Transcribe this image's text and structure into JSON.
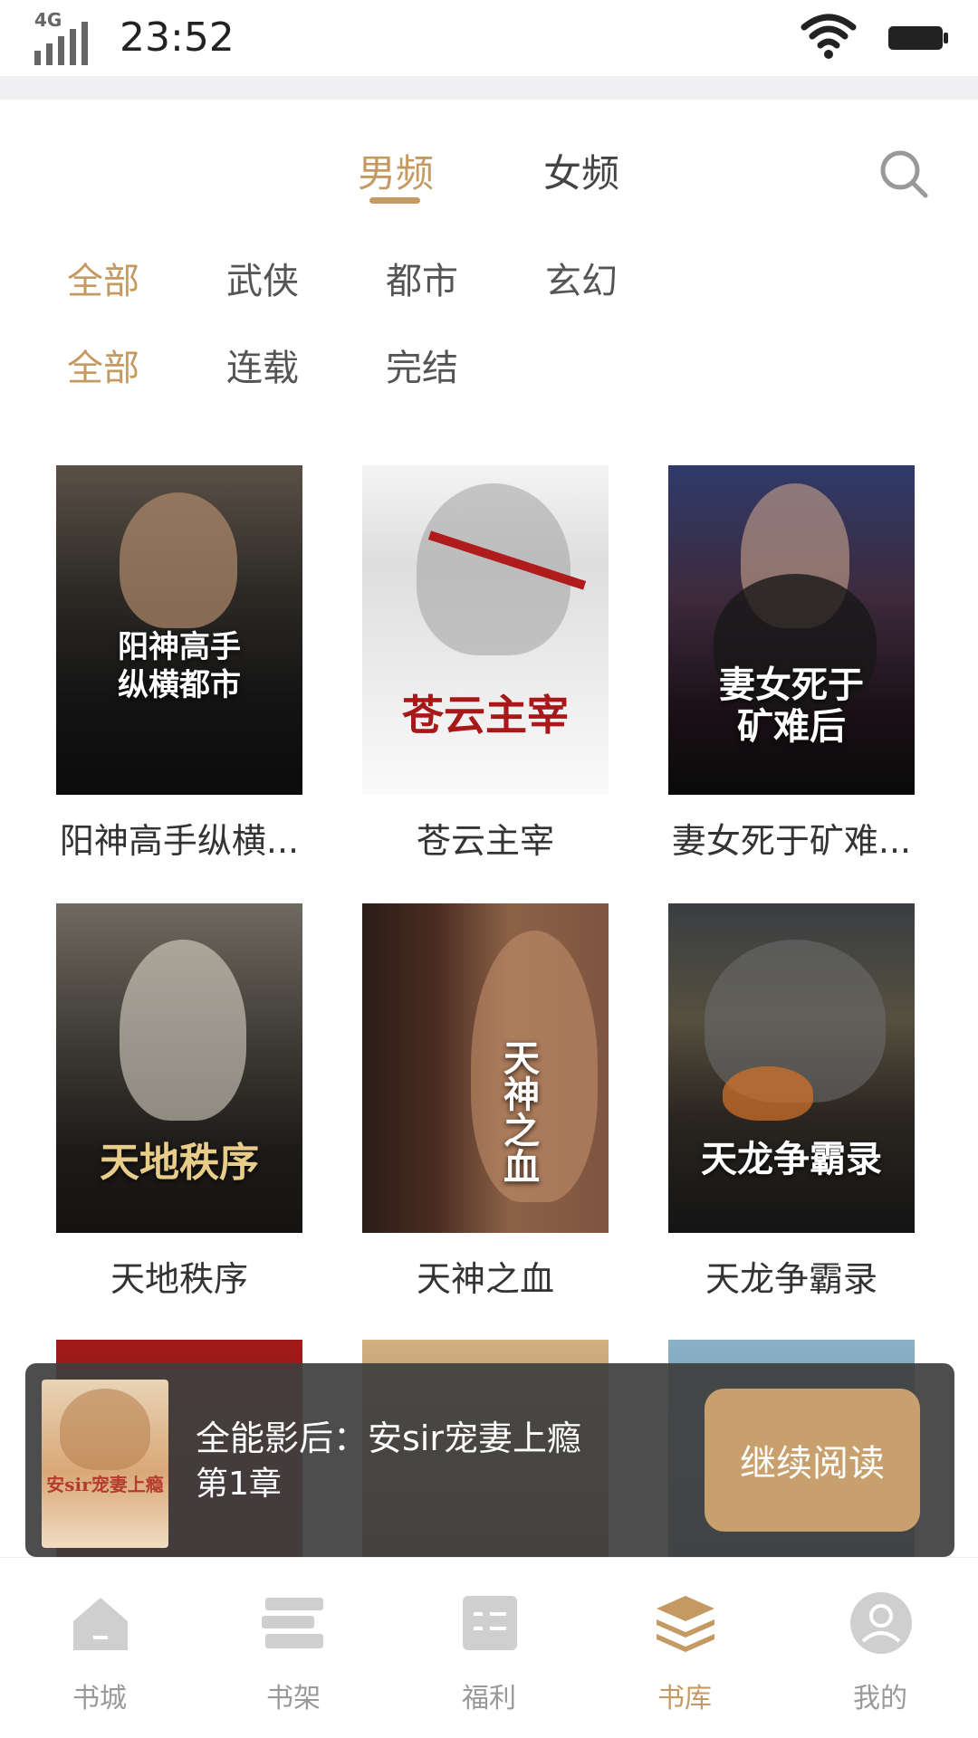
{
  "status_bar": {
    "network": "4G",
    "time": "23:52"
  },
  "channel_tabs": {
    "male": "男频",
    "female": "女频",
    "active": "male"
  },
  "filters": {
    "category": [
      "全部",
      "武侠",
      "都市",
      "玄幻"
    ],
    "status": [
      "全部",
      "连载",
      "完结"
    ]
  },
  "books": [
    {
      "title": "阳神高手纵横...",
      "cover_title": "阳神高手\n纵横都市"
    },
    {
      "title": "苍云主宰",
      "cover_title": "苍云主宰"
    },
    {
      "title": "妻女死于矿难...",
      "cover_title": "妻女死于\n矿难后"
    },
    {
      "title": "天地秩序",
      "cover_title": "天地秩序"
    },
    {
      "title": "天神之血",
      "cover_title": "天神之血"
    },
    {
      "title": "天龙争霸录",
      "cover_title": "天龙争霸录"
    }
  ],
  "continue_reading": {
    "book_title": "全能影后：安sir宠妻上瘾",
    "chapter": "第1章",
    "button": "继续阅读",
    "cover_title": "安sir宠妻上瘾"
  },
  "bottom_nav": [
    {
      "label": "书城",
      "icon": "home-icon"
    },
    {
      "label": "书架",
      "icon": "bookshelf-icon"
    },
    {
      "label": "福利",
      "icon": "welfare-icon"
    },
    {
      "label": "书库",
      "icon": "library-icon"
    },
    {
      "label": "我的",
      "icon": "profile-icon"
    }
  ],
  "colors": {
    "accent": "#c49a62",
    "continue_bar": "#404040",
    "continue_button": "#c8a06d"
  }
}
